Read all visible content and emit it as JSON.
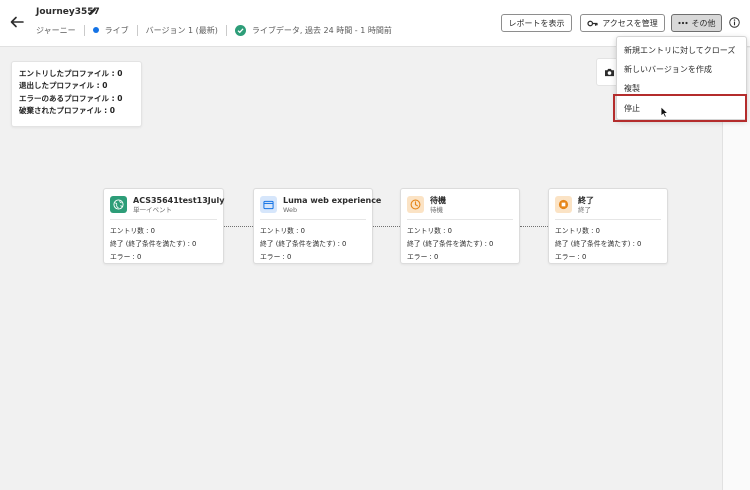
{
  "header": {
    "title": "Journey3557",
    "type_label": "ジャーニー",
    "status_label": "ライブ",
    "version_label": "バージョン 1 (最新)",
    "data_label": "ライブデータ, 過去 24 時間 - 1 時間前",
    "buttons": {
      "report": "レポートを表示",
      "access": "アクセスを管理",
      "more": "その他"
    }
  },
  "stats": [
    "エントリしたプロファイル : 0",
    "退出したプロファイル : 0",
    "エラーのあるプロファイル : 0",
    "破棄されたプロファイル : 0"
  ],
  "nodes": [
    {
      "title": "ACS35641test13July",
      "subtitle": "単一イベント",
      "icon": "globe-icon",
      "color": "#2d9d78",
      "stats": [
        "エントリ数 : 0",
        "終了 (終了条件を満たす) : 0",
        "エラー : 0"
      ]
    },
    {
      "title": "Luma web experience",
      "subtitle": "Web",
      "icon": "web-page-icon",
      "color": "#1473e6",
      "stats": [
        "エントリ数 : 0",
        "終了 (終了条件を満たす) : 0",
        "エラー : 0"
      ]
    },
    {
      "title": "待機",
      "subtitle": "待機",
      "icon": "clock-icon",
      "color": "#e68619",
      "stats": [
        "エントリ数 : 0",
        "終了 (終了条件を満たす) : 0",
        "エラー : 0"
      ]
    },
    {
      "title": "終了",
      "subtitle": "終了",
      "icon": "stop-icon",
      "color": "#e68619",
      "stats": [
        "エントリ数 : 0",
        "終了 (終了条件を満たす) : 0",
        "エラー : 0"
      ]
    }
  ],
  "menu": {
    "items": [
      "新規エントリに対してクローズ",
      "新しいバージョンを作成",
      "複製",
      "停止"
    ]
  }
}
